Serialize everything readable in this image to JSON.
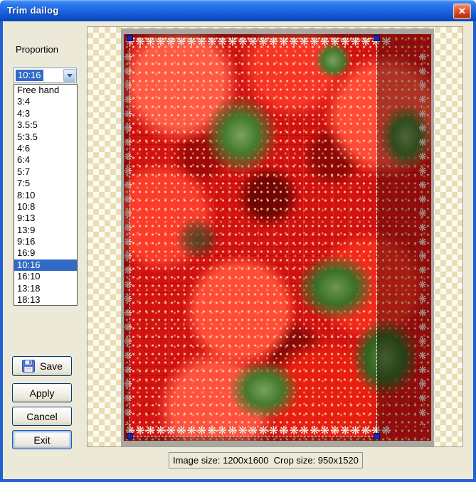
{
  "window": {
    "title": "Trim dailog",
    "close_glyph": "✕"
  },
  "sidebar": {
    "proportion_label": "Proportion",
    "combo_value": "10:16",
    "options": [
      "Free hand",
      "3:4",
      "4:3",
      "3.5:5",
      "5:3.5",
      "4:6",
      "6:4",
      "5:7",
      "7:5",
      "8:10",
      "10:8",
      "9:13",
      "13:9",
      "9:16",
      "16:9",
      "10:16",
      "16:10",
      "13:18",
      "18:13"
    ],
    "selected_index": 15,
    "buttons": {
      "save": "Save",
      "apply": "Apply",
      "cancel": "Cancel",
      "exit": "Exit"
    }
  },
  "canvas": {
    "ornament_glyph": "❋",
    "image_size": "1200x1600",
    "crop_size": "950x1520"
  },
  "status": {
    "text": "Image size: 1200x1600  Crop size: 950x1520"
  },
  "colors": {
    "titlebar_blue": "#1b61de",
    "dialog_bg": "#ece9d8",
    "selection_highlight": "#316ac5",
    "checker_tan": "#e8ddb4",
    "checker_cream": "#fdfaf0",
    "crop_handle_blue": "#1726b8",
    "photo_red": "#d31212"
  }
}
